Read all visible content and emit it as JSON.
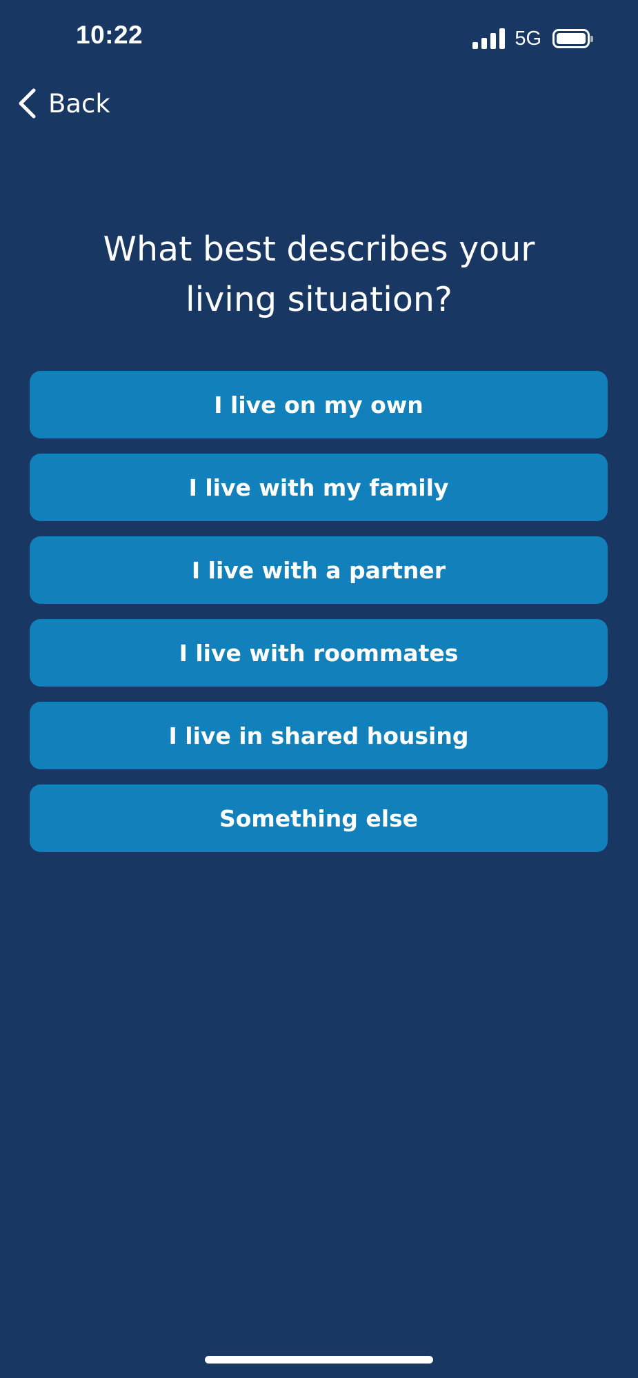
{
  "status_bar": {
    "time": "10:22",
    "network": "5G",
    "signal_icon": "cellular-signal-icon",
    "battery_icon": "battery-icon"
  },
  "nav": {
    "back_label": "Back",
    "back_icon": "chevron-left-icon"
  },
  "question": {
    "line1": "What best describes your",
    "line2": "living situation?"
  },
  "options": [
    {
      "label": "I live on my own"
    },
    {
      "label": "I live with my family"
    },
    {
      "label": "I live with a partner"
    },
    {
      "label": "I live with roommates"
    },
    {
      "label": "I live in shared housing"
    },
    {
      "label": "Something else"
    }
  ],
  "colors": {
    "background": "#183863",
    "button": "#1280bb",
    "text": "#ffffff"
  }
}
